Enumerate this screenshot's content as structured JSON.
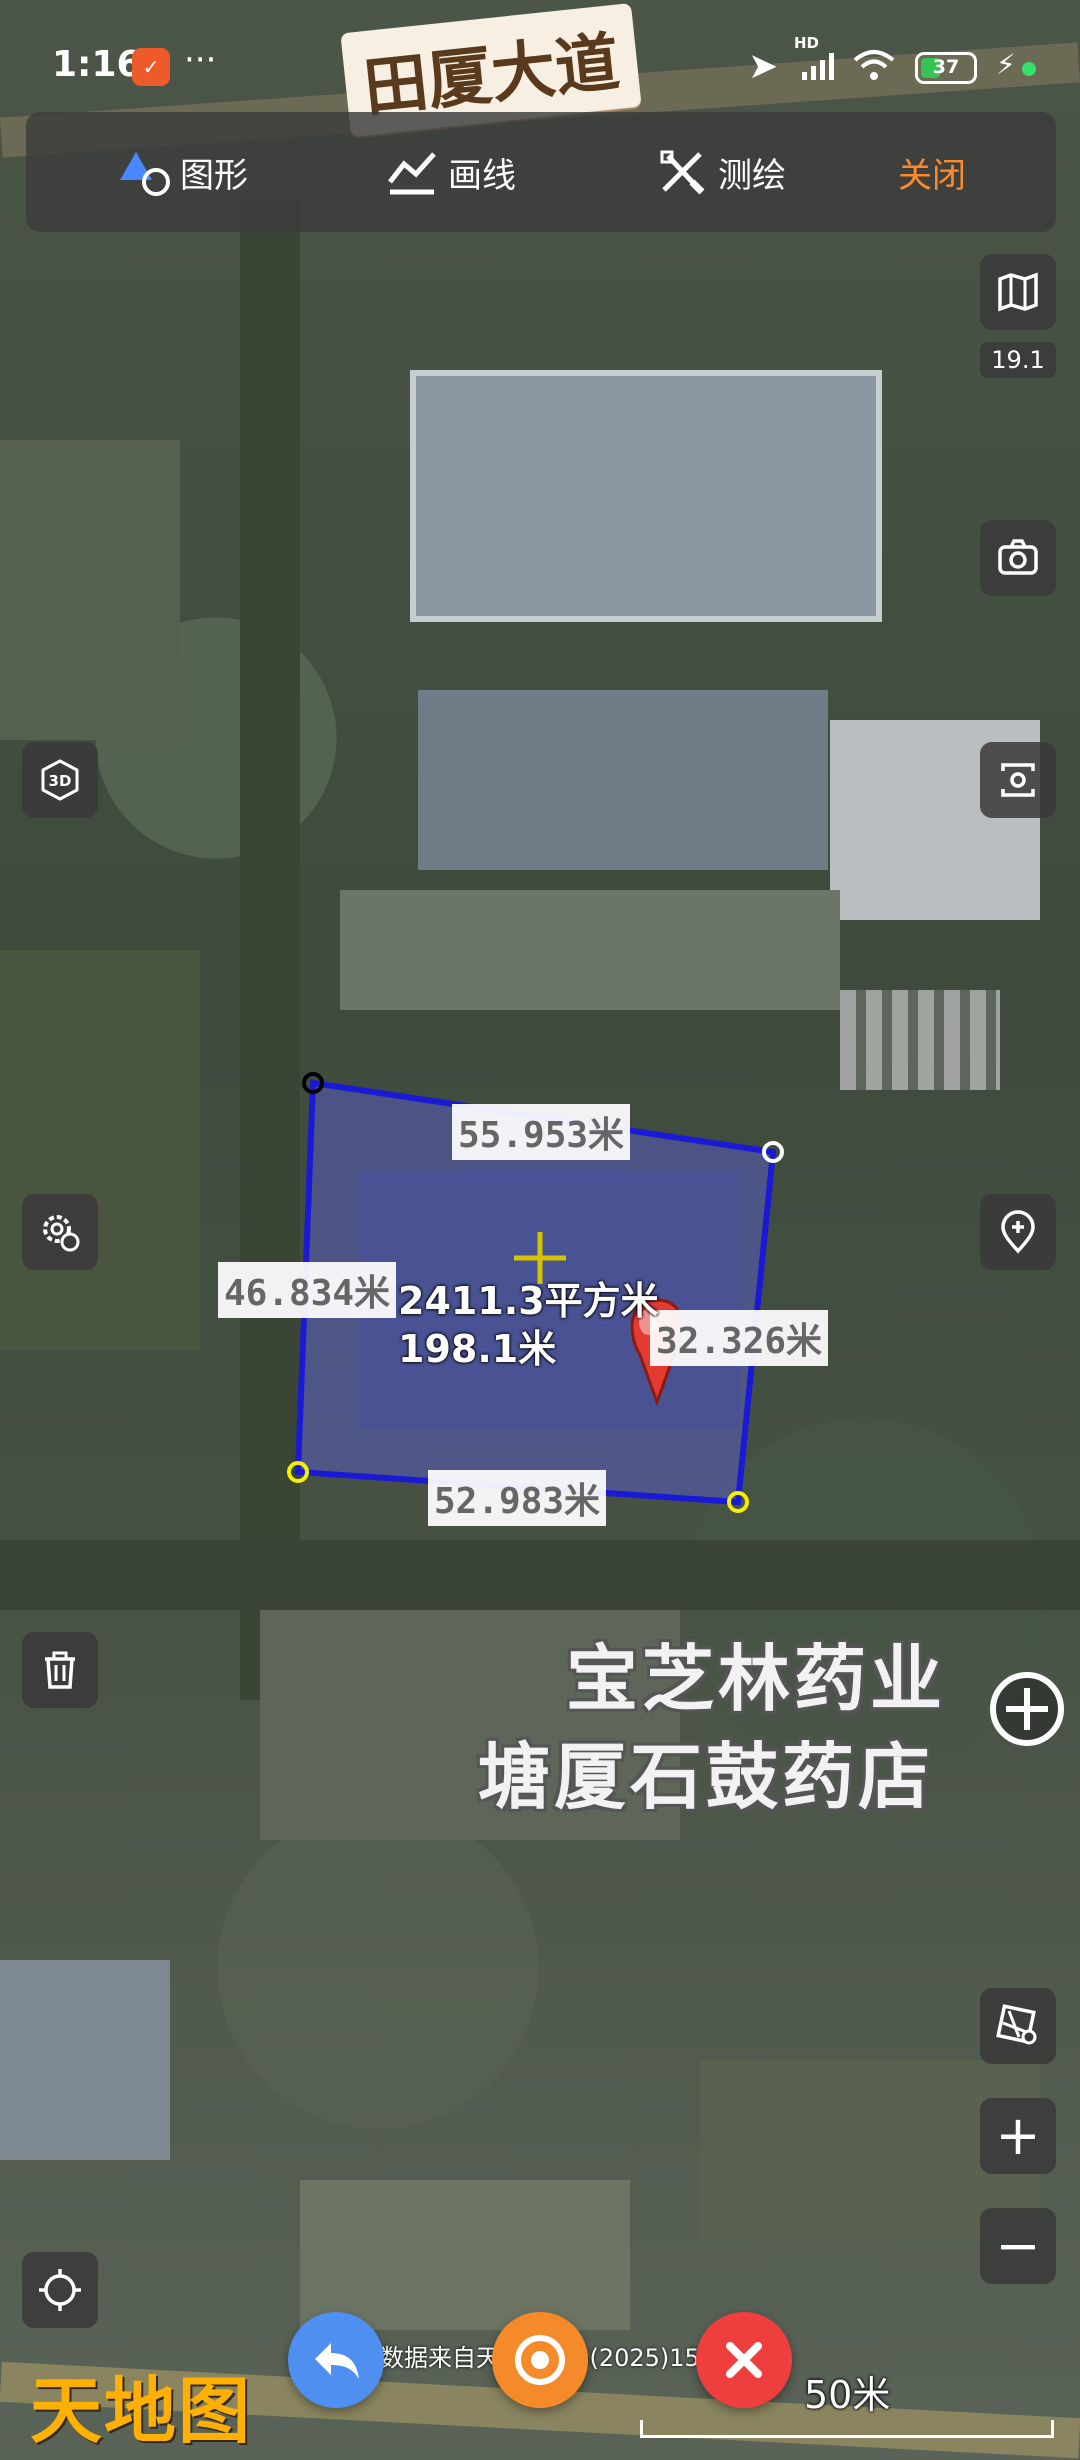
{
  "status_bar": {
    "time": "1:16",
    "app_icon": "app-notification-icon",
    "more": "···",
    "hd": "HD",
    "battery_level": "37",
    "battery_fraction": 0.37
  },
  "road_label": "田厦大道",
  "toolbar": {
    "items": [
      {
        "label": "图形",
        "icon": "shape-icon"
      },
      {
        "label": "画线",
        "icon": "draw-line-icon"
      },
      {
        "label": "测绘",
        "icon": "survey-icon"
      },
      {
        "label": "关闭"
      }
    ]
  },
  "right_controls": {
    "layers_icon": "map-layers-icon",
    "zoom_level": "19.1",
    "screenshot_icon": "camera-icon",
    "rotate_icon": "rotate-camera-icon",
    "add_location_icon": "add-location-icon",
    "map_grid_icon": "map-grid-icon",
    "zoom_in": "+",
    "zoom_out": "−"
  },
  "left_controls": {
    "three_d": "3D",
    "settings_icon": "settings-icon",
    "delete_icon": "trash-icon",
    "locate_icon": "locate-icon"
  },
  "measurement": {
    "sides": [
      "55.953米",
      "32.326米",
      "52.983米",
      "46.834米"
    ],
    "area": "2411.3平方米",
    "perimeter": "198.1米"
  },
  "pois": {
    "line1": "宝芝林药业",
    "line2": "塘厦石鼓药店"
  },
  "bottom": {
    "logo": "天地图",
    "attribution": "数据来自天地图 GS(2025)1508号",
    "undo_icon": "undo-icon",
    "target_icon": "target-icon",
    "cancel_icon": "close-icon",
    "scale": "50米"
  },
  "colors": {
    "accent_orange": "#ff8a2a",
    "polygon_blue": "#1a1ad6",
    "undo_blue": "#4f8ff0",
    "target_orange": "#f58a2b",
    "cancel_red": "#ef3e3e",
    "logo_gold": "#ffb000",
    "marker_red": "#e33a32"
  }
}
